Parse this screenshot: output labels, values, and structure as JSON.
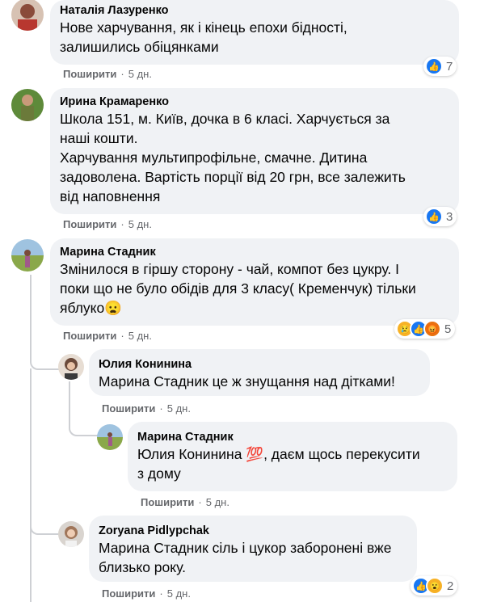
{
  "comments": [
    {
      "author": "Наталія Лазуренко",
      "lines": [
        "Нове харчування, як і кінець епохи бідності,",
        "залишились обіцянками"
      ],
      "share_label": "Поширити",
      "time": "5 дн.",
      "reactions": {
        "icons": [
          "like"
        ],
        "count": "7"
      }
    },
    {
      "author": "Ирина Крамаренко",
      "lines": [
        "Школа 151, м. Київ, дочка в 6 класі. Харчується за",
        "наші кошти.",
        "Харчування мультипрофільне, смачне. Дитина",
        "задоволена. Вартість порції від 20 грн, все залежить",
        "від наповнення"
      ],
      "share_label": "Поширити",
      "time": "5 дн.",
      "reactions": {
        "icons": [
          "like"
        ],
        "count": "3"
      }
    },
    {
      "author": "Марина Стадник",
      "lines": [
        "Змінилося в гіршу сторону - чай, компот без цукру. І",
        "поки що не було обідів для 3 класу( Кременчук) тільки",
        "яблуко😦"
      ],
      "share_label": "Поширити",
      "time": "5 дн.",
      "reactions": {
        "icons": [
          "sad",
          "like",
          "angry"
        ],
        "count": "5"
      }
    },
    {
      "author": "Юлия Конинина",
      "lines": [
        "Марина Стадник це ж знущання над дітками!"
      ],
      "share_label": "Поширити",
      "time": "5 дн."
    },
    {
      "author": "Марина Стадник",
      "lines": [
        "Юлия Конинина 💯, даєм щось перекусити",
        "з дому"
      ],
      "share_label": "Поширити",
      "time": "5 дн."
    },
    {
      "author": "Zoryana Pidlypchak",
      "lines": [
        "Марина Стадник сіль і цукор заборонені вже",
        "близько року."
      ],
      "share_label": "Поширити",
      "time": "5 дн.",
      "reactions": {
        "icons": [
          "like",
          "wow"
        ],
        "count": "2"
      }
    }
  ],
  "reaction_icons": {
    "like": "👍",
    "sad": "😢",
    "angry": "😡",
    "wow": "😮"
  },
  "colors": {
    "bubble": "#f0f2f5",
    "meta": "#65676b",
    "like": "#1877f2"
  }
}
